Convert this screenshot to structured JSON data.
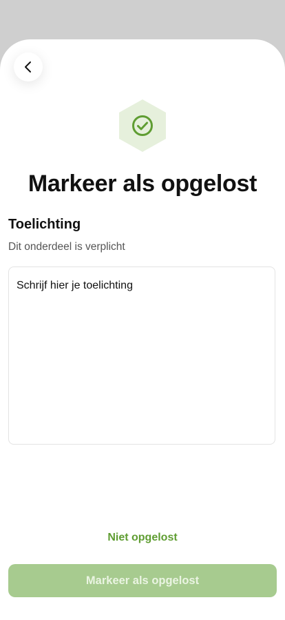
{
  "header": {
    "back_icon": "chevron-left-icon"
  },
  "status_icon": "check-circle-icon",
  "colors": {
    "accent": "#5f9d32",
    "accent_light": "#e6f0dc",
    "button_disabled": "#a7cb8f"
  },
  "page": {
    "title": "Markeer als opgelost"
  },
  "explanation": {
    "label": "Toelichting",
    "hint": "Dit onderdeel is verplicht",
    "placeholder": "Schrijf hier je toelichting",
    "value": ""
  },
  "actions": {
    "secondary_label": "Niet opgelost",
    "primary_label": "Markeer als opgelost"
  }
}
